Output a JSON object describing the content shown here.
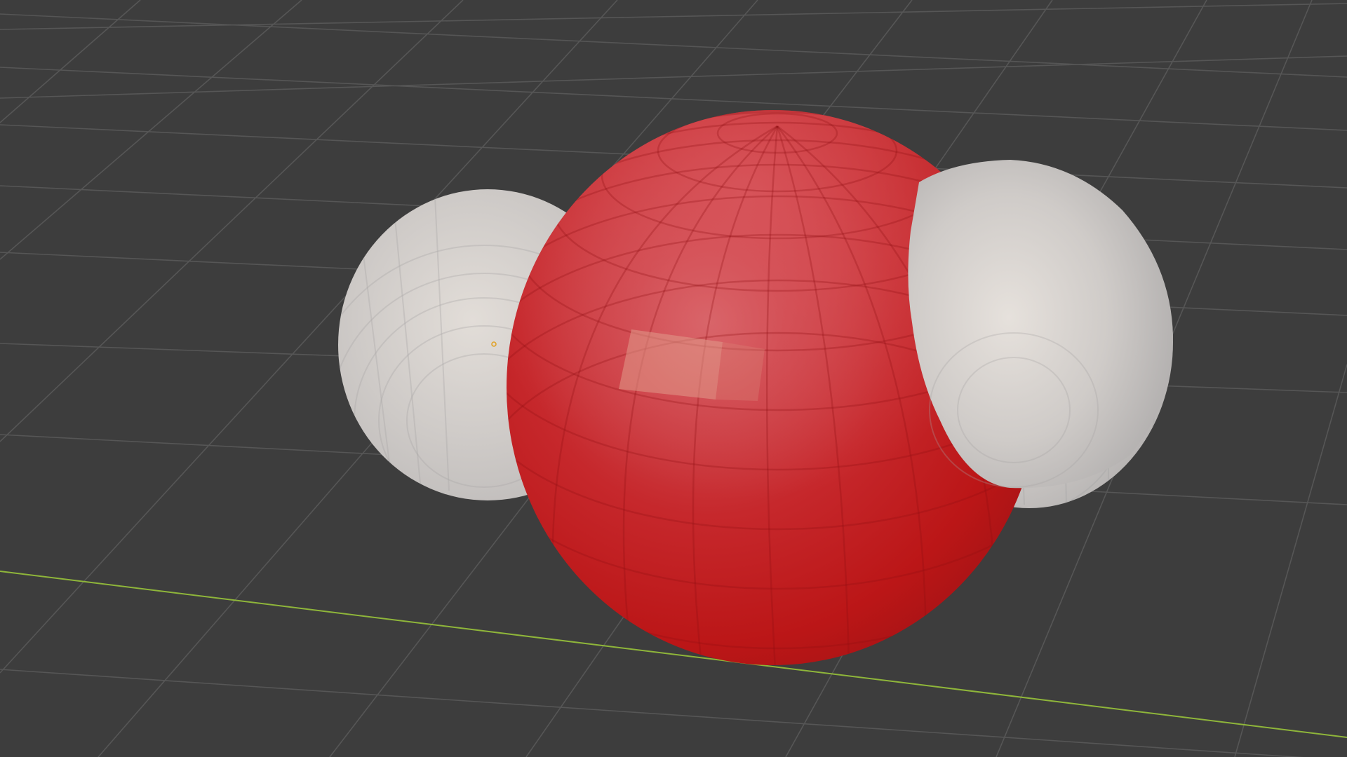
{
  "app": {
    "name": "3D viewport"
  },
  "viewport": {
    "background_color": "#3d3d3d",
    "grid": {
      "visible": true,
      "line_color": "#565656",
      "x_axis_color": "#8fb63a"
    },
    "scene": {
      "objects": [
        {
          "name": "oxygen-atom",
          "role": "center sphere",
          "color": "#c9171a",
          "highlight_color": "#d86a6e"
        },
        {
          "name": "hydrogen-atom-left",
          "role": "sphere",
          "color": "#c9c5c2",
          "highlight_color": "#e6e1dc"
        },
        {
          "name": "hydrogen-atom-right",
          "role": "sphere",
          "color": "#c9c5c2",
          "highlight_color": "#e6e1dc"
        }
      ],
      "origin_marker": {
        "visible": true,
        "color": "#e0a32a"
      }
    }
  }
}
